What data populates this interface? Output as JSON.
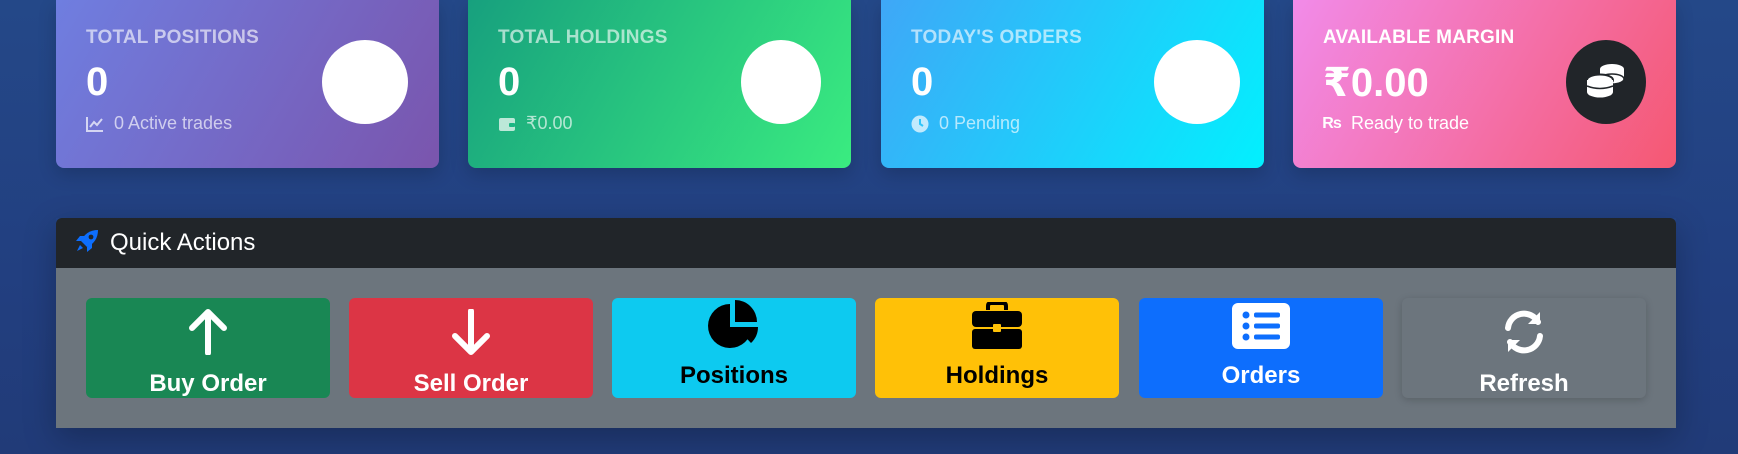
{
  "cards": [
    {
      "label": "TOTAL POSITIONS",
      "value": "0",
      "sub": "0 Active trades",
      "icon": "chart-line-icon"
    },
    {
      "label": "TOTAL HOLDINGS",
      "value": "0",
      "sub": "₹0.00",
      "icon": "wallet-icon"
    },
    {
      "label": "TODAY'S ORDERS",
      "value": "0",
      "sub": "0 Pending",
      "icon": "clock-icon"
    },
    {
      "label": "AVAILABLE MARGIN",
      "value": "₹0.00",
      "sub": "Ready to trade",
      "icon": "rupee-icon",
      "badge_icon": "coins-icon"
    }
  ],
  "quick_actions": {
    "title": "Quick Actions",
    "buttons": [
      {
        "label": "Buy Order",
        "icon": "arrow-up-icon"
      },
      {
        "label": "Sell Order",
        "icon": "arrow-down-icon"
      },
      {
        "label": "Positions",
        "icon": "pie-chart-icon"
      },
      {
        "label": "Holdings",
        "icon": "briefcase-icon"
      },
      {
        "label": "Orders",
        "icon": "list-icon"
      },
      {
        "label": "Refresh",
        "icon": "refresh-icon"
      }
    ]
  },
  "colors": {
    "buy": "#198754",
    "sell": "#dc3545",
    "positions": "#0dcaf0",
    "holdings": "#ffc107",
    "orders": "#0d6efd",
    "refresh": "#6c757d",
    "header": "#212529",
    "accent": "#0d6efd"
  }
}
